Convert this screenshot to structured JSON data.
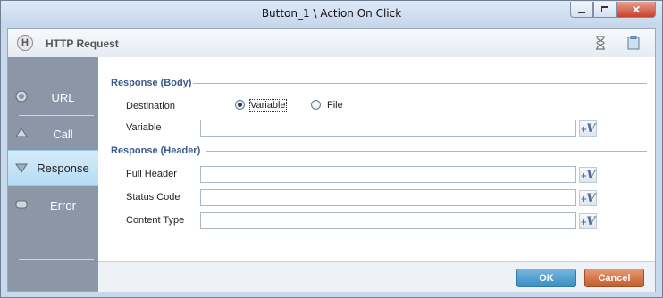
{
  "window": {
    "title": "Button_1 \\ Action On Click",
    "min_icon": "minimize-icon",
    "max_icon": "maximize-icon",
    "close_icon": "close-icon"
  },
  "header": {
    "title": "HTTP Request",
    "logo_letter": "H",
    "icons": [
      "hourglass-icon",
      "clipboard-icon"
    ]
  },
  "sidebar": {
    "items": [
      {
        "label": "URL",
        "icon": "globe-icon",
        "active": false
      },
      {
        "label": "Call",
        "icon": "call-icon",
        "active": false
      },
      {
        "label": "Response",
        "icon": "response-icon",
        "active": true
      },
      {
        "label": "Error",
        "icon": "error-icon",
        "active": false
      }
    ]
  },
  "response_body": {
    "section_title": "Response (Body)",
    "destination_label": "Destination",
    "options": [
      {
        "label": "Variable",
        "checked": true
      },
      {
        "label": "File",
        "checked": false
      }
    ],
    "variable_label": "Variable",
    "variable_value": ""
  },
  "response_header": {
    "section_title": "Response (Header)",
    "fields": [
      {
        "label": "Full Header",
        "value": ""
      },
      {
        "label": "Status Code",
        "value": ""
      },
      {
        "label": "Content Type",
        "value": ""
      }
    ]
  },
  "variable_button": {
    "symbol": "V",
    "plus": "+",
    "icon": "variable-picker-icon"
  },
  "footer": {
    "ok_label": "OK",
    "cancel_label": "Cancel"
  },
  "colors": {
    "ok": "#3a8fc4",
    "cancel": "#c65b2b",
    "sidebar": "#8b97a6",
    "section": "#3a5a8c"
  }
}
